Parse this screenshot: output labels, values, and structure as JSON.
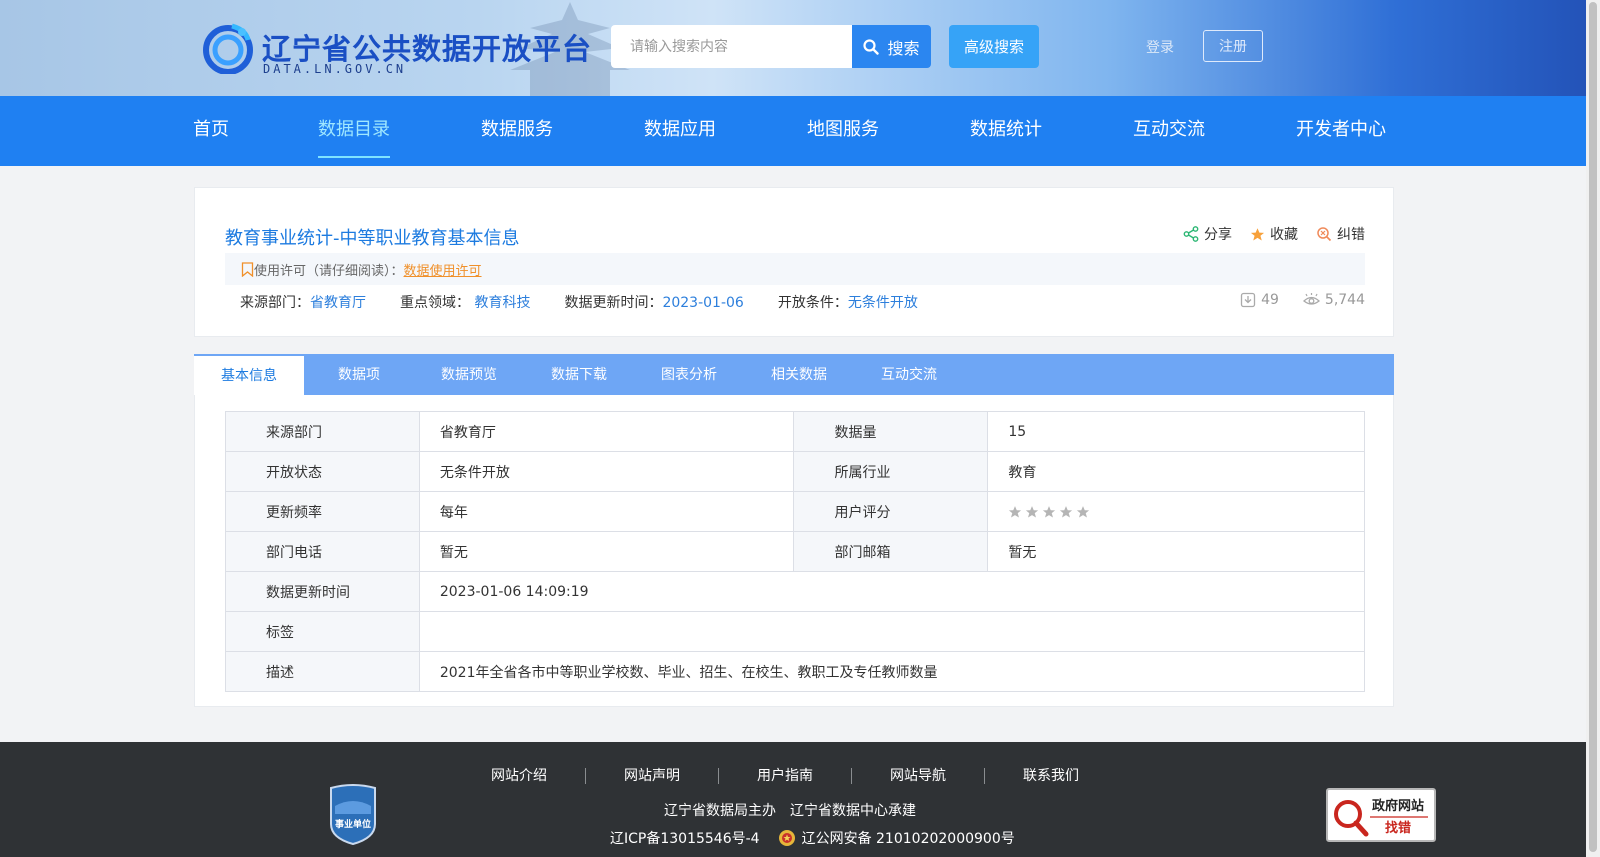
{
  "header": {
    "logo_title": "辽宁省公共数据开放平台",
    "logo_sub": "DATA.LN.GOV.CN",
    "search_placeholder": "请输入搜索内容",
    "search_label": "搜索",
    "advanced_search_label": "高级搜索",
    "login_label": "登录",
    "register_label": "注册"
  },
  "nav": {
    "items": [
      {
        "label": "首页"
      },
      {
        "label": "数据目录"
      },
      {
        "label": "数据服务"
      },
      {
        "label": "数据应用"
      },
      {
        "label": "地图服务"
      },
      {
        "label": "数据统计"
      },
      {
        "label": "互动交流"
      },
      {
        "label": "开发者中心"
      }
    ],
    "active": "数据目录"
  },
  "dataset": {
    "title": "教育事业统计-中等职业教育基本信息",
    "actions": {
      "share": "分享",
      "favorite": "收藏",
      "report": "纠错"
    },
    "license_prefix": "使用许可（请仔细阅读）：",
    "license_link": "数据使用许可",
    "meta": {
      "source_label": "来源部门：",
      "source_value": "省教育厅",
      "domain_label": "重点领域： ",
      "domain_value": "教育科技",
      "updated_label": "数据更新时间：",
      "updated_value": "2023-01-06",
      "open_label": "开放条件：",
      "open_value": "无条件开放"
    },
    "downloads": "49",
    "views": "5,744"
  },
  "tabs": {
    "items": [
      {
        "label": "基本信息"
      },
      {
        "label": "数据项"
      },
      {
        "label": "数据预览"
      },
      {
        "label": "数据下载"
      },
      {
        "label": "图表分析"
      },
      {
        "label": "相关数据"
      },
      {
        "label": "互动交流"
      }
    ],
    "active": "基本信息"
  },
  "info": {
    "source_dept_label": "来源部门",
    "source_dept": "省教育厅",
    "data_count_label": "数据量",
    "data_count": "15",
    "open_status_label": "开放状态",
    "open_status": "无条件开放",
    "industry_label": "所属行业",
    "industry": "教育",
    "frequency_label": "更新频率",
    "frequency": "每年",
    "rating_label": "用户评分",
    "rating": 0,
    "rating_max": 5,
    "phone_label": "部门电话",
    "phone": "暂无",
    "email_label": "部门邮箱",
    "email": "暂无",
    "update_time_label": "数据更新时间",
    "update_time": "2023-01-06 14:09:19",
    "tags_label": "标签",
    "tags": "",
    "description_label": "描述",
    "description": "2021年全省各市中等职业学校数、毕业、招生、在校生、教职工及专任教师数量"
  },
  "footer": {
    "links": [
      {
        "label": "网站介绍"
      },
      {
        "label": "网站声明"
      },
      {
        "label": "用户指南"
      },
      {
        "label": "网站导航"
      },
      {
        "label": "联系我们"
      }
    ],
    "host": "辽宁省数据局主办",
    "builder": "辽宁省数据中心承建",
    "icp": "辽ICP备13015546号-4",
    "police": "辽公网安备 21010202000900号",
    "badge_text": "事业单位",
    "findbug_line1": "政府网站",
    "findbug_line2": "找错"
  },
  "colors": {
    "nav_bg": "#1f80f2",
    "accent": "#1d7be0",
    "tabs_bg": "#6ea6f5",
    "license_link": "#f0902a",
    "footer_bg": "#2f3235"
  }
}
